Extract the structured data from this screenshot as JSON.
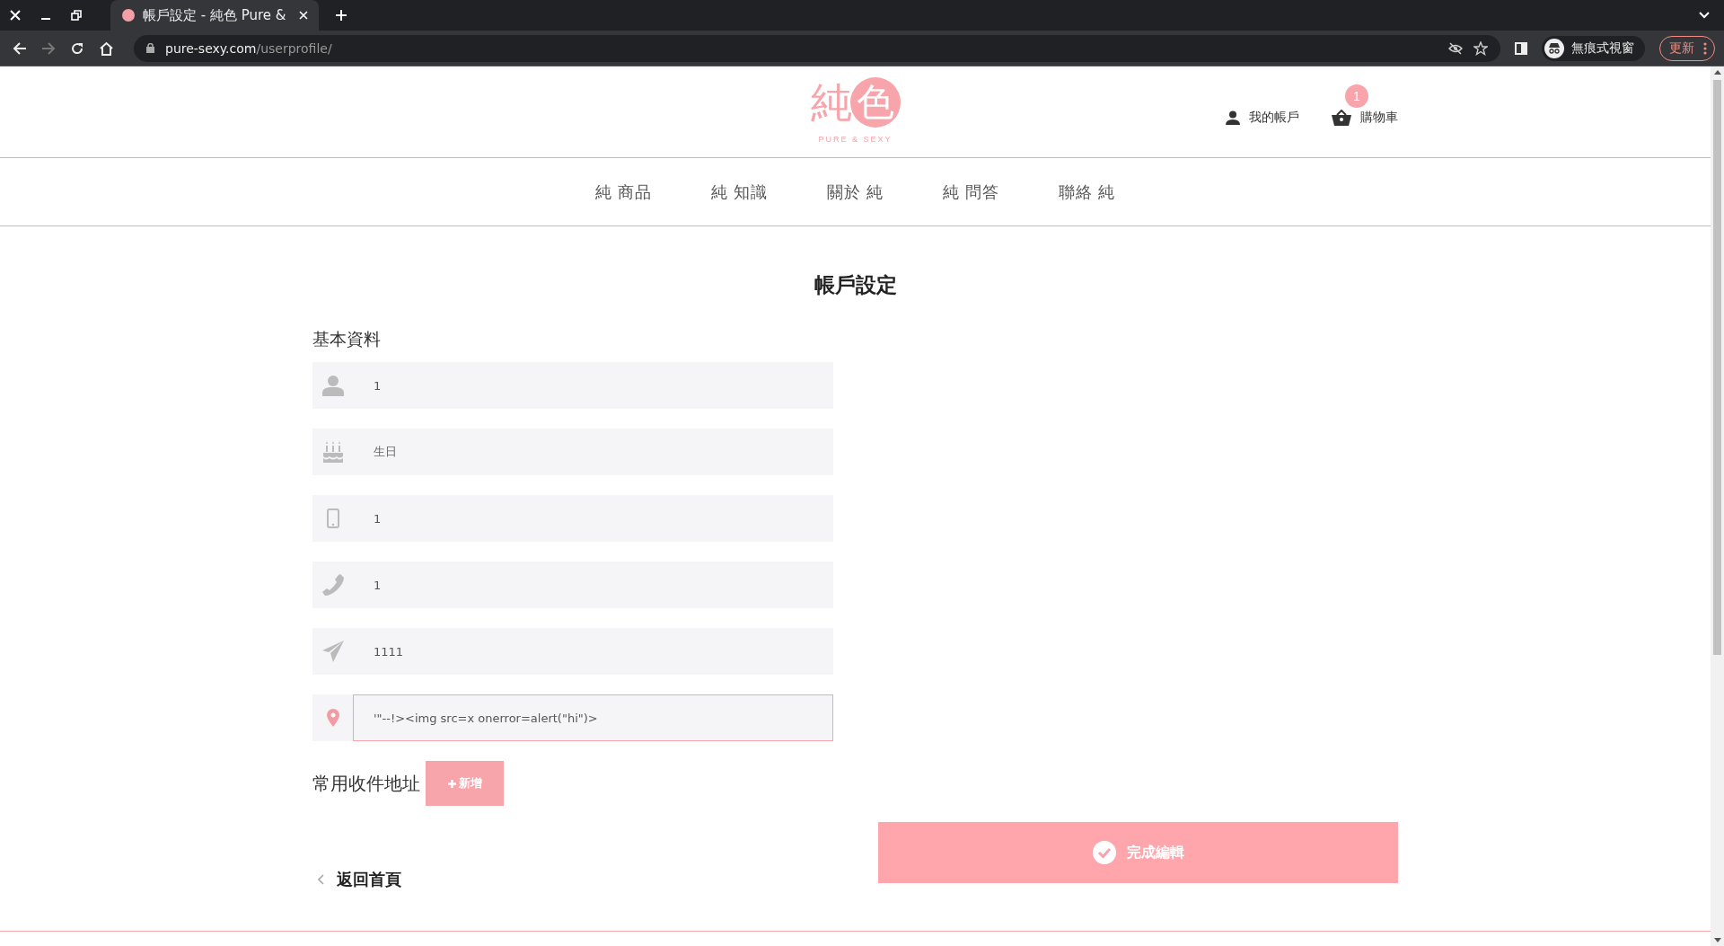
{
  "browser": {
    "tab_title": "帳戶設定 - 純色 Pure &",
    "url_host": "pure-sexy.com",
    "url_path": "/userprofile/",
    "profile_label": "無痕式視窗",
    "update_label": "更新"
  },
  "logo": {
    "mark_left": "純",
    "mark_right": "色",
    "tagline": "PURE & SEXY"
  },
  "account": {
    "label": "我的帳戶"
  },
  "cart": {
    "label": "購物車",
    "count": "1"
  },
  "nav": [
    {
      "label": "純 商品"
    },
    {
      "label": "純 知識"
    },
    {
      "label": "關於 純"
    },
    {
      "label": "純 問答"
    },
    {
      "label": "聯絡 純"
    }
  ],
  "page_title": "帳戶設定",
  "section_title": "基本資料",
  "fields": [
    {
      "kind": "name",
      "value": "1",
      "focused": false
    },
    {
      "kind": "birthday",
      "placeholder": "生日",
      "focused": false
    },
    {
      "kind": "mobile",
      "value": "1",
      "focused": false
    },
    {
      "kind": "phone",
      "value": "1",
      "focused": false
    },
    {
      "kind": "postcode",
      "value": "1111",
      "focused": false
    },
    {
      "kind": "address",
      "value": "'\"--!><img src=x onerror=alert(\"hi\")>",
      "focused": true
    }
  ],
  "addresses": {
    "label": "常用收件地址",
    "add_button": "新增"
  },
  "submit_button": "完成編輯",
  "back_link": "返回首頁"
}
